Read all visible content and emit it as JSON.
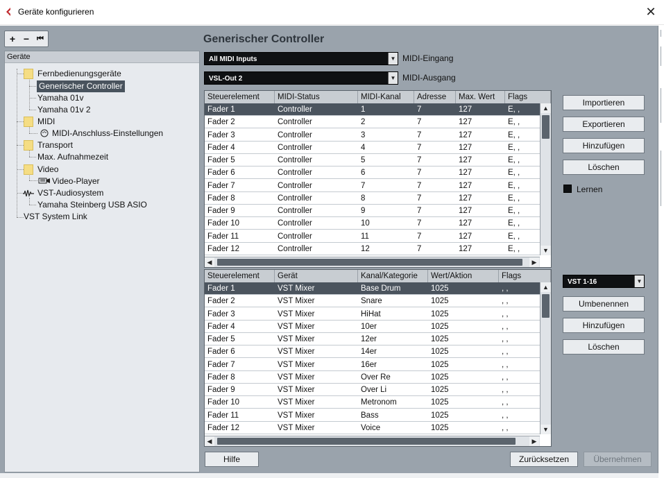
{
  "window": {
    "title": "Geräte konfigurieren",
    "close_glyph": "✕"
  },
  "left": {
    "toolbar": {
      "add": "+",
      "remove": "−",
      "reset": "⏮"
    },
    "header": "Geräte",
    "tree": [
      {
        "label": "Fernbedienungsgeräte",
        "kind": "folder"
      },
      {
        "label": "Generischer Controller",
        "kind": "child",
        "selected": true
      },
      {
        "label": "Yamaha 01v",
        "kind": "child"
      },
      {
        "label": "Yamaha 01v 2",
        "kind": "child"
      },
      {
        "label": "MIDI",
        "kind": "folder"
      },
      {
        "label": "MIDI-Anschluss-Einstellungen",
        "kind": "child-icon",
        "icon": "midi-port-icon"
      },
      {
        "label": "Transport",
        "kind": "folder"
      },
      {
        "label": "Max. Aufnahmezeit",
        "kind": "child"
      },
      {
        "label": "Video",
        "kind": "folder"
      },
      {
        "label": "Video-Player",
        "kind": "child-icon",
        "icon": "video-icon"
      },
      {
        "label": "VST-Audiosystem",
        "kind": "audio",
        "icon": "audio-system-icon"
      },
      {
        "label": "Yamaha Steinberg USB ASIO",
        "kind": "child"
      },
      {
        "label": "VST System Link",
        "kind": "plain"
      }
    ]
  },
  "main": {
    "title": "Generischer Controller",
    "midi_in": {
      "value": "All MIDI Inputs",
      "label": "MIDI-Eingang"
    },
    "midi_out": {
      "value": "VSL-Out 2",
      "label": "MIDI-Ausgang"
    },
    "table1": {
      "headers": [
        "Steuerelement",
        "MIDI-Status",
        "MIDI-Kanal",
        "Adresse",
        "Max. Wert",
        "Flags"
      ],
      "rows": [
        [
          "Fader 1",
          "Controller",
          "1",
          "7",
          "127",
          "E, ,"
        ],
        [
          "Fader 2",
          "Controller",
          "2",
          "7",
          "127",
          "E, ,"
        ],
        [
          "Fader 3",
          "Controller",
          "3",
          "7",
          "127",
          "E, ,"
        ],
        [
          "Fader 4",
          "Controller",
          "4",
          "7",
          "127",
          "E, ,"
        ],
        [
          "Fader 5",
          "Controller",
          "5",
          "7",
          "127",
          "E, ,"
        ],
        [
          "Fader 6",
          "Controller",
          "6",
          "7",
          "127",
          "E, ,"
        ],
        [
          "Fader 7",
          "Controller",
          "7",
          "7",
          "127",
          "E, ,"
        ],
        [
          "Fader 8",
          "Controller",
          "8",
          "7",
          "127",
          "E, ,"
        ],
        [
          "Fader 9",
          "Controller",
          "9",
          "7",
          "127",
          "E, ,"
        ],
        [
          "Fader 10",
          "Controller",
          "10",
          "7",
          "127",
          "E, ,"
        ],
        [
          "Fader 11",
          "Controller",
          "11",
          "7",
          "127",
          "E, ,"
        ],
        [
          "Fader 12",
          "Controller",
          "12",
          "7",
          "127",
          "E, ,"
        ]
      ]
    },
    "table2": {
      "headers": [
        "Steuerelement",
        "Gerät",
        "Kanal/Kategorie",
        "Wert/Aktion",
        "Flags"
      ],
      "rows": [
        [
          "Fader 1",
          "VST Mixer",
          "Base Drum",
          "1025",
          ", ,"
        ],
        [
          "Fader 2",
          "VST Mixer",
          "Snare",
          "1025",
          ", ,"
        ],
        [
          "Fader 3",
          "VST Mixer",
          "HiHat",
          "1025",
          ", ,"
        ],
        [
          "Fader 4",
          "VST Mixer",
          "10er",
          "1025",
          ", ,"
        ],
        [
          "Fader 5",
          "VST Mixer",
          "12er",
          "1025",
          ", ,"
        ],
        [
          "Fader 6",
          "VST Mixer",
          "14er",
          "1025",
          ", ,"
        ],
        [
          "Fader 7",
          "VST Mixer",
          "16er",
          "1025",
          ", ,"
        ],
        [
          "Fader 8",
          "VST Mixer",
          "Over Re",
          "1025",
          ", ,"
        ],
        [
          "Fader 9",
          "VST Mixer",
          "Over Li",
          "1025",
          ", ,"
        ],
        [
          "Fader 10",
          "VST Mixer",
          "Metronom",
          "1025",
          ", ,"
        ],
        [
          "Fader 11",
          "VST Mixer",
          "Bass",
          "1025",
          ", ,"
        ],
        [
          "Fader 12",
          "VST Mixer",
          "Voice",
          "1025",
          ", ,"
        ]
      ]
    }
  },
  "right": {
    "import": "Importieren",
    "export": "Exportieren",
    "add1": "Hinzufügen",
    "delete1": "Löschen",
    "learn": "Lernen",
    "bank": "VST 1-16",
    "rename": "Umbenennen",
    "add2": "Hinzufügen",
    "delete2": "Löschen"
  },
  "footer": {
    "help": "Hilfe",
    "reset": "Zurücksetzen",
    "apply": "Übernehmen"
  },
  "colors": {
    "frame": "#9aa3ac",
    "selected_row": "#4b545e",
    "dropdown": "#0f1113",
    "accent_icon": "#c0282d"
  }
}
